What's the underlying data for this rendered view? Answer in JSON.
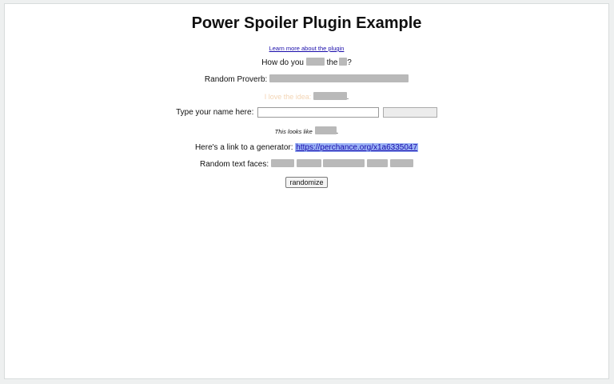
{
  "page": {
    "title": "Power Spoiler Plugin Example",
    "learn_more_link": "Learn more about the plugin"
  },
  "rows": {
    "how_do_you": {
      "prefix": "How do you",
      "middle": "the",
      "suffix": "?"
    },
    "random_proverb": {
      "label": "Random Proverb:"
    },
    "love_idea": {
      "text": "I love the idea:",
      "suffix": "."
    },
    "name_prompt": {
      "label": "Type your name here:",
      "value": "",
      "placeholder": ""
    },
    "looks_like": {
      "text": "This looks like",
      "suffix": "."
    },
    "generator": {
      "label": "Here's a link to a generator:",
      "link": "https://perchance.org/x1a6335047"
    },
    "text_faces": {
      "label": "Random text faces:"
    }
  },
  "buttons": {
    "randomize": "randomize"
  },
  "colors": {
    "spoiler_block": "#b9b9b9",
    "link": "#1a0dab",
    "link_highlight": "#9bb3f5",
    "faded_text": "#f3d5b5"
  }
}
